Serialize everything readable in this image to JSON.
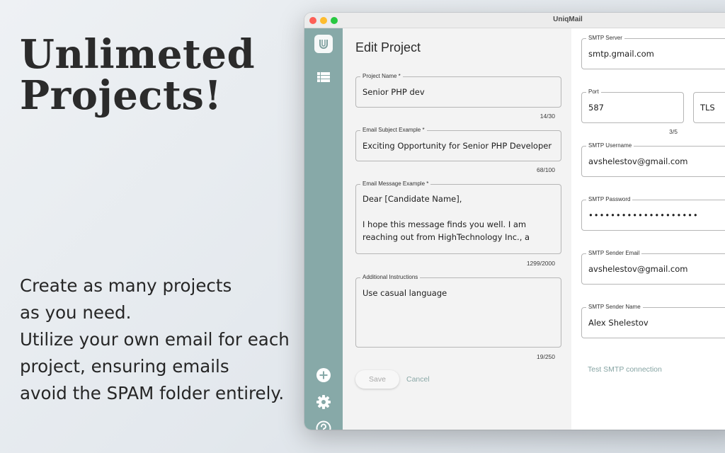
{
  "marketing": {
    "headline_line1": "Unlimeted",
    "headline_line2": "Projects!",
    "body_lines": [
      "Create as many projects",
      "as you need.",
      "Utilize your own email for each",
      "project, ensuring emails",
      "avoid the SPAM folder entirely."
    ]
  },
  "window": {
    "title": "UniqMail"
  },
  "sidebar": {
    "icons": [
      "app-logo-icon",
      "list-icon",
      "add-circle-icon",
      "gear-icon",
      "help-circle-icon"
    ],
    "accent_color": "#87a9a8"
  },
  "edit_project": {
    "title": "Edit Project",
    "project_name": {
      "label": "Project Name *",
      "value": "Senior PHP dev",
      "counter": "14/30"
    },
    "email_subject": {
      "label": "Email Subject Example *",
      "value": "Exciting Opportunity for Senior PHP Developer",
      "counter": "68/100"
    },
    "email_message": {
      "label": "Email Message Example *",
      "line1": "Dear [Candidate Name],",
      "line2": "I hope this message finds you well. I am",
      "line3": "reaching out from HighTechnology Inc., a",
      "counter": "1299/2000"
    },
    "additional_instructions": {
      "label": "Additional Instructions",
      "value": "Use casual language",
      "counter": "19/250"
    },
    "save_label": "Save",
    "cancel_label": "Cancel"
  },
  "smtp": {
    "server": {
      "label": "SMTP Server",
      "value": "smtp.gmail.com"
    },
    "port": {
      "label": "Port",
      "value": "587",
      "counter": "3/5"
    },
    "security": {
      "value": "TLS"
    },
    "username": {
      "label": "SMTP Username",
      "value": "avshelestov@gmail.com"
    },
    "password": {
      "label": "SMTP Password",
      "value": "••••••••••••••••••••"
    },
    "sender_email": {
      "label": "SMTP Sender Email",
      "value": "avshelestov@gmail.com"
    },
    "sender_name": {
      "label": "SMTP Sender Name",
      "value": "Alex Shelestov"
    },
    "test_link_label": "Test SMTP connection"
  }
}
